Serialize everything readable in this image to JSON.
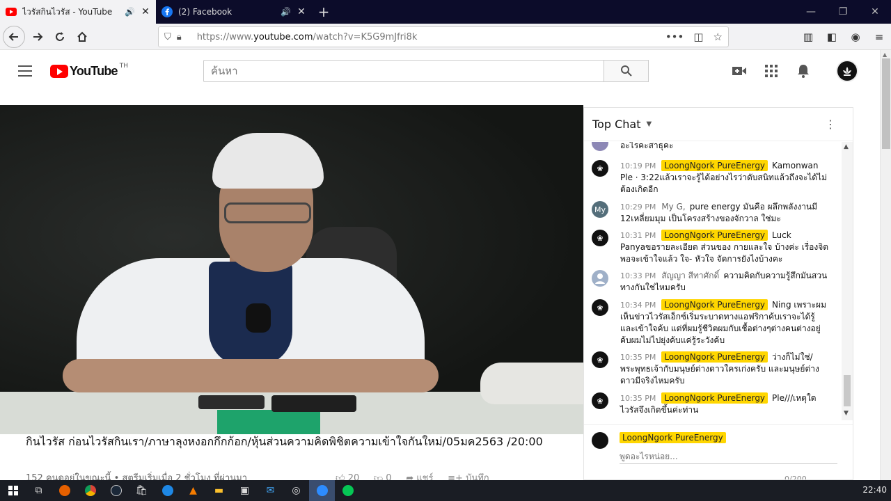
{
  "browser": {
    "tabs": [
      {
        "title": "ไวรัสกินไวรัส - YouTube",
        "audio": "🔊",
        "close": "✕"
      },
      {
        "title": "(2) Facebook",
        "audio": "🔊",
        "close": "✕"
      }
    ],
    "new_tab": "+",
    "url_prefix": "https://www.",
    "url_domain": "youtube.com",
    "url_path": "/watch?v=K5G9mJfri8k"
  },
  "youtube": {
    "logo_text": "YouTube",
    "country_code": "TH",
    "search_placeholder": "ค้นหา"
  },
  "video": {
    "title": "กินไวรัส ก่อนไวรัสกินเรา/ภาษาลุงหงอกกึกก้อก/หุ้นส่วนความคิดพิชิตความเข้าใจกันใหม่/05มค2563 /20:00",
    "meta": "152 คนดูอยู่ในขณะนี้ • สตรีมเริ่มเมื่อ 2 ชั่วโมง ที่ผ่านมา",
    "likes": "20",
    "dislikes": "0",
    "share": "แชร์",
    "save": "บันทึก"
  },
  "chat": {
    "header": "Top Chat",
    "messages": [
      {
        "time": "",
        "author": "",
        "owner": "",
        "text": "อะไรคะสาธุคะ",
        "avatar": "dark",
        "initials": ""
      },
      {
        "time": "10:19 PM",
        "author": "",
        "owner": "LoongNgork PureEnergy",
        "text": "Kamonwan Ple · 3:22แล้วเราจะรู้ได้อย่างไรว่าดับสนิทแล้วถึงจะได้ไม่ต้องเกิดอีก",
        "avatar": "dark",
        "initials": ""
      },
      {
        "time": "10:29 PM",
        "author": "My G,",
        "owner": "",
        "text": "pure energy มันคือ ผลึกพลังงานมี 12เหลี่ยมมุม เป็นโครงสร้างของจักวาล ใช่มะ",
        "avatar": "my",
        "initials": "My"
      },
      {
        "time": "10:31 PM",
        "author": "",
        "owner": "LoongNgork PureEnergy",
        "text": "Luck Panyaขอรายละเอียด ส่วนของ กายและใจ บ้างค่ะ เรื่องจิตพอจะเข้าใจแล้ว ใจ- หัวใจ จัดการยังไงบ้างคะ",
        "avatar": "dark",
        "initials": ""
      },
      {
        "time": "10:33 PM",
        "author": "สัญญา สีทาศักดิ์",
        "owner": "",
        "text": "ความคิดกับความรู้สึกมันสวนทางกันใช่ไหมครับ",
        "avatar": "gray",
        "initials": ""
      },
      {
        "time": "10:34 PM",
        "author": "",
        "owner": "LoongNgork PureEnergy",
        "text": "Ning เพราะผมเห็นข่าวไวรัสเอ็กซ์เริ่มระบาดทางแอฟริกาค้บเราจะได้รู้และเข้าใจค้บ แต่ที่ผมรู้ชีวิตผมกับเชื้อต่างๆต่างคนต่างอยู่ค้บผมไม่ไปยุ่งค้บแค่รู้ระวังค้บ",
        "avatar": "dark",
        "initials": ""
      },
      {
        "time": "10:35 PM",
        "author": "",
        "owner": "LoongNgork PureEnergy",
        "text": "ว่างก็ไม่ใช่/พระพุทธเจ้ากับมนุษย์ต่างดาวใครเก่งครับ และมนุษย์ต่างดาวมีจริงไหมครับ",
        "avatar": "dark",
        "initials": ""
      },
      {
        "time": "10:35 PM",
        "author": "",
        "owner": "LoongNgork PureEnergy",
        "text": "Ple///เหตุใดไวรัสจึงเกิดขึ้นค่ะท่าน",
        "avatar": "dark",
        "initials": ""
      }
    ],
    "composer_owner": "LoongNgork PureEnergy",
    "composer_placeholder": "พูดอะไรหน่อย...",
    "counter": "0/200"
  },
  "taskbar": {
    "clock": "22:40"
  },
  "colors": {
    "yt_red": "#ff0000",
    "owner_badge": "#ffd600",
    "tabbar": "#0c0c2a"
  }
}
